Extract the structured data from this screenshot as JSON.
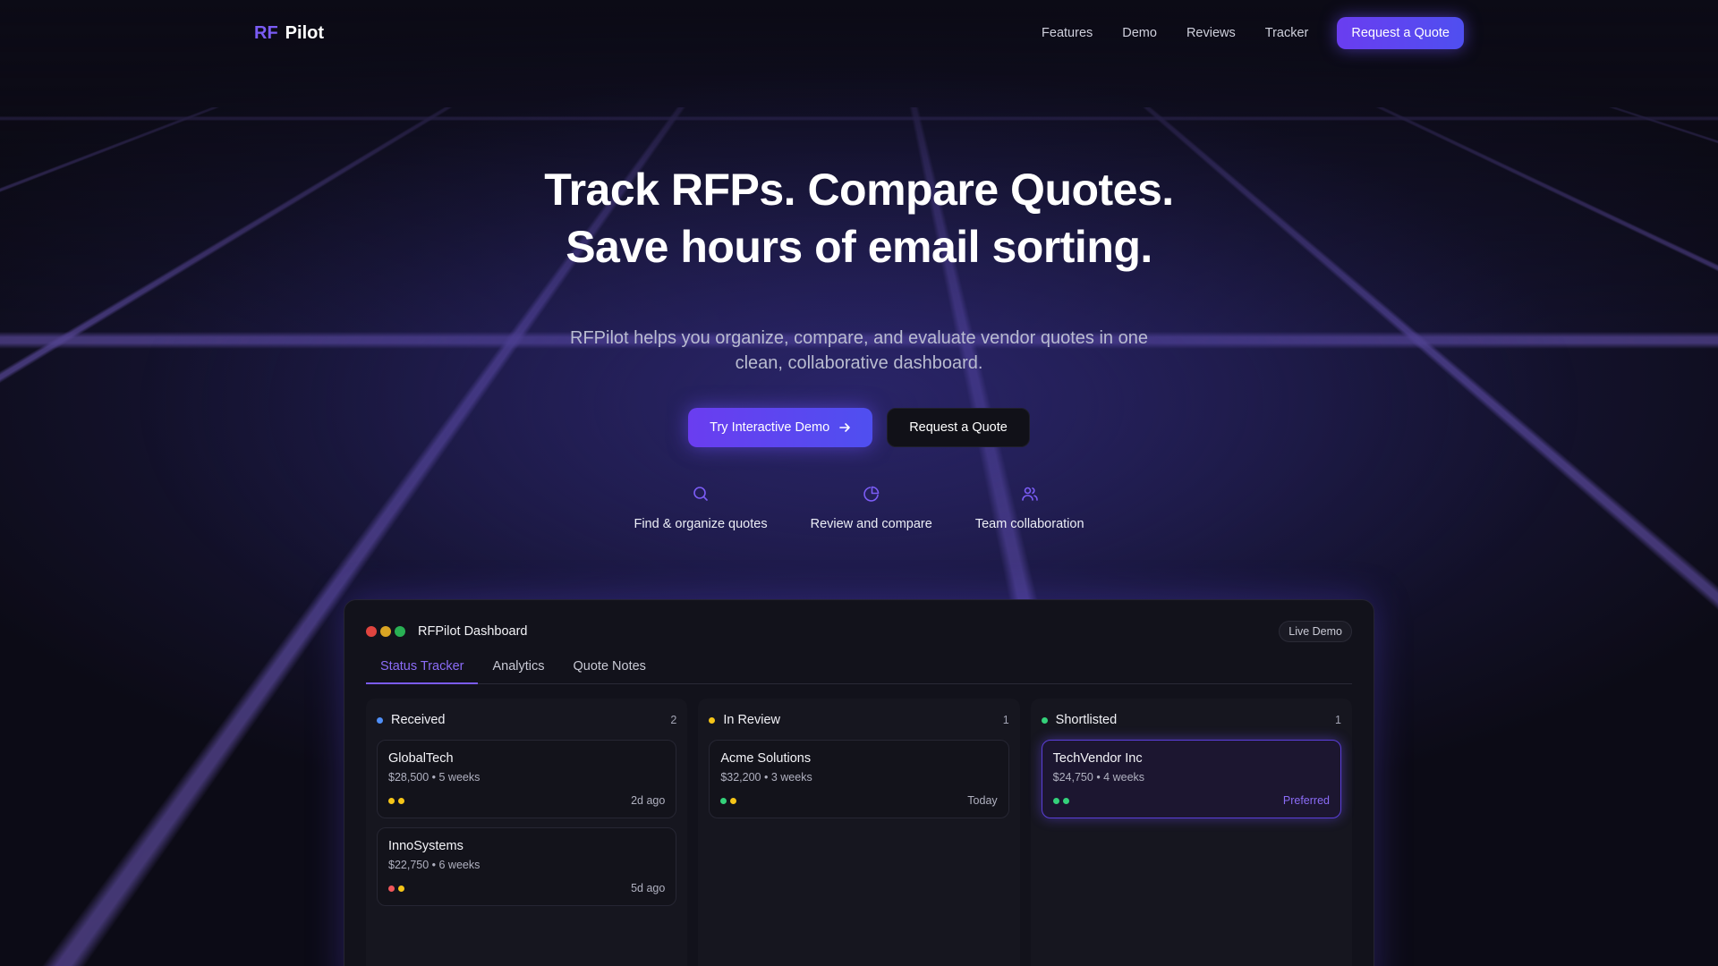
{
  "nav": {
    "logo_rf": "RF",
    "logo_pilot": "Pilot",
    "links": [
      "Features",
      "Demo",
      "Reviews",
      "Tracker"
    ],
    "cta": "Request a Quote"
  },
  "hero": {
    "title_line1": "Track RFPs. Compare Quotes.",
    "title_line2": "Save hours of email sorting.",
    "subtitle": "RFPilot helps you organize, compare, and evaluate vendor quotes in one clean, collaborative dashboard.",
    "primary_cta": "Try Interactive Demo",
    "secondary_cta": "Request a Quote",
    "features": [
      {
        "icon": "search-icon",
        "label": "Find & organize quotes"
      },
      {
        "icon": "pie-chart-icon",
        "label": "Review and compare"
      },
      {
        "icon": "users-icon",
        "label": "Team collaboration"
      }
    ]
  },
  "colors": {
    "accent": "#7b5cf5",
    "received": "#4f8ff7",
    "in_review": "#f5c518",
    "shortlisted": "#34d17a",
    "red": "#f0565a"
  },
  "dashboard": {
    "title": "RFPilot Dashboard",
    "badge": "Live Demo",
    "tabs": [
      "Status Tracker",
      "Analytics",
      "Quote Notes"
    ],
    "columns": [
      {
        "title": "Received",
        "count": "2",
        "cards": [
          {
            "name": "GlobalTech",
            "meta": "$28,500 • 5 weeks",
            "time": "2d ago"
          },
          {
            "name": "InnoSystems",
            "meta": "$22,750 • 6 weeks",
            "time": "5d ago"
          }
        ]
      },
      {
        "title": "In Review",
        "count": "1",
        "cards": [
          {
            "name": "Acme Solutions",
            "meta": "$32,200 • 3 weeks",
            "time": "Today"
          }
        ]
      },
      {
        "title": "Shortlisted",
        "count": "1",
        "cards": [
          {
            "name": "TechVendor Inc",
            "meta": "$24,750 • 4 weeks",
            "time": "Preferred"
          }
        ]
      }
    ]
  }
}
